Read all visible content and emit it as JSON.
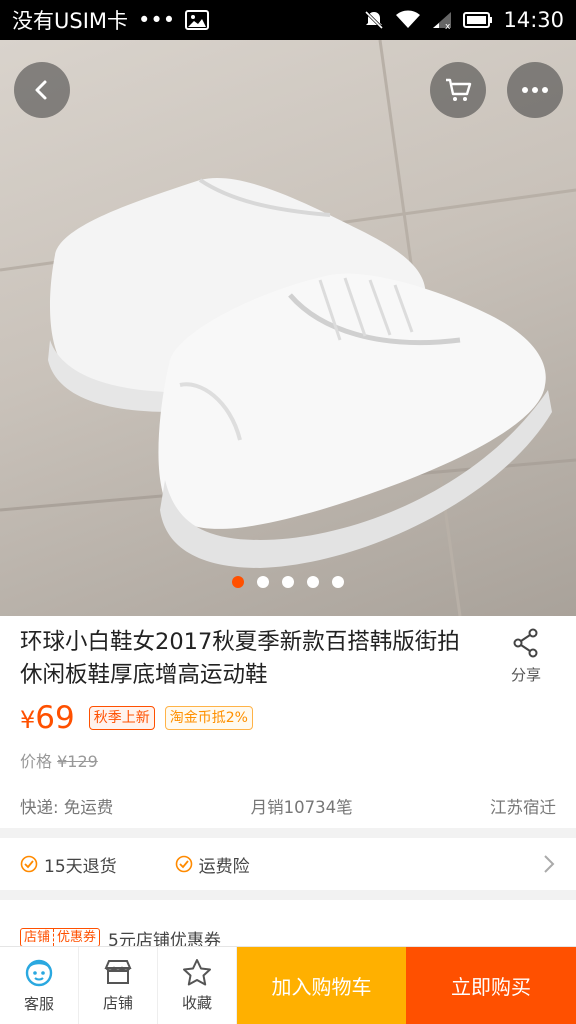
{
  "status_bar": {
    "carrier": "没有USIM卡",
    "dots": "•••",
    "time": "14:30",
    "icons": [
      "image-icon",
      "mute-icon",
      "wifi-icon",
      "signal-icon",
      "battery-icon"
    ]
  },
  "hero": {
    "image": "white-sneakers-product-photo",
    "carousel": {
      "count": 5,
      "active_index": 0
    },
    "buttons": [
      "back-icon",
      "cart-icon",
      "more-icon"
    ]
  },
  "product": {
    "title": "环球小白鞋女2017秋夏季新款百搭韩版街拍休闲板鞋厚底增高运动鞋",
    "share_label": "分享",
    "currency": "¥",
    "price": "69",
    "tags": {
      "season": "秋季上新",
      "coin": "淘金币抵2%"
    },
    "orig_label": "价格",
    "orig_price": "¥129",
    "shipping": "快递: 免运费",
    "sales": "月销10734笔",
    "location": "江苏宿迁"
  },
  "services": {
    "return": "15天退货",
    "insurance": "运费险"
  },
  "coupon": {
    "badge_left": "店铺",
    "badge_right": "优惠券",
    "text": "5元店铺优惠券"
  },
  "bottom_bar": {
    "service": "客服",
    "shop": "店铺",
    "favorite": "收藏",
    "add_to_cart": "加入购物车",
    "buy_now": "立即购买"
  },
  "colors": {
    "accent": "#ff5000",
    "cart_button": "#ffb000",
    "status_bar": "#000000"
  }
}
